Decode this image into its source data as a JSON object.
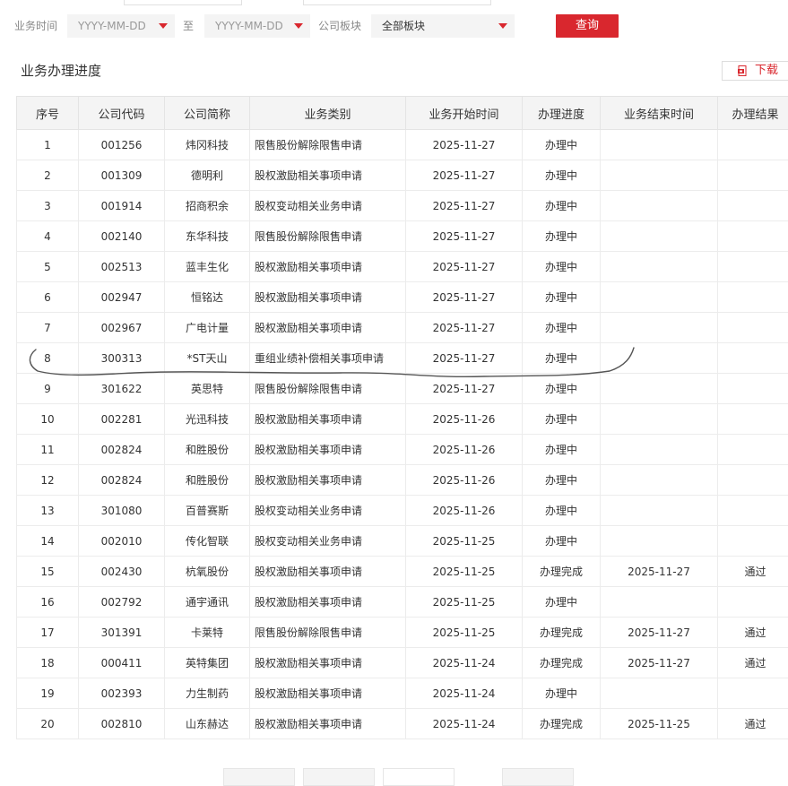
{
  "filters": {
    "date_label": "业务时间",
    "start_placeholder": "YYYY-MM-DD",
    "separator": "至",
    "end_placeholder": "YYYY-MM-DD",
    "board_label": "公司板块",
    "board_value": "全部板块",
    "query_button": "查询"
  },
  "section": {
    "title": "业务办理进度",
    "download_label": "下载"
  },
  "table": {
    "columns": [
      "序号",
      "公司代码",
      "公司简称",
      "业务类别",
      "业务开始时间",
      "办理进度",
      "业务结束时间",
      "办理结果"
    ],
    "rows": [
      [
        "1",
        "001256",
        "炜冈科技",
        "限售股份解除限售申请",
        "2025-11-27",
        "办理中",
        "",
        ""
      ],
      [
        "2",
        "001309",
        "德明利",
        "股权激励相关事项申请",
        "2025-11-27",
        "办理中",
        "",
        ""
      ],
      [
        "3",
        "001914",
        "招商积余",
        "股权变动相关业务申请",
        "2025-11-27",
        "办理中",
        "",
        ""
      ],
      [
        "4",
        "002140",
        "东华科技",
        "限售股份解除限售申请",
        "2025-11-27",
        "办理中",
        "",
        ""
      ],
      [
        "5",
        "002513",
        "蓝丰生化",
        "股权激励相关事项申请",
        "2025-11-27",
        "办理中",
        "",
        ""
      ],
      [
        "6",
        "002947",
        "恒铭达",
        "股权激励相关事项申请",
        "2025-11-27",
        "办理中",
        "",
        ""
      ],
      [
        "7",
        "002967",
        "广电计量",
        "股权激励相关事项申请",
        "2025-11-27",
        "办理中",
        "",
        ""
      ],
      [
        "8",
        "300313",
        "*ST天山",
        "重组业绩补偿相关事项申请",
        "2025-11-27",
        "办理中",
        "",
        ""
      ],
      [
        "9",
        "301622",
        "英思特",
        "限售股份解除限售申请",
        "2025-11-27",
        "办理中",
        "",
        ""
      ],
      [
        "10",
        "002281",
        "光迅科技",
        "股权激励相关事项申请",
        "2025-11-26",
        "办理中",
        "",
        ""
      ],
      [
        "11",
        "002824",
        "和胜股份",
        "股权激励相关事项申请",
        "2025-11-26",
        "办理中",
        "",
        ""
      ],
      [
        "12",
        "002824",
        "和胜股份",
        "股权激励相关事项申请",
        "2025-11-26",
        "办理中",
        "",
        ""
      ],
      [
        "13",
        "301080",
        "百普赛斯",
        "股权变动相关业务申请",
        "2025-11-26",
        "办理中",
        "",
        ""
      ],
      [
        "14",
        "002010",
        "传化智联",
        "股权变动相关业务申请",
        "2025-11-25",
        "办理中",
        "",
        ""
      ],
      [
        "15",
        "002430",
        "杭氧股份",
        "股权激励相关事项申请",
        "2025-11-25",
        "办理完成",
        "2025-11-27",
        "通过"
      ],
      [
        "16",
        "002792",
        "通宇通讯",
        "股权激励相关事项申请",
        "2025-11-25",
        "办理中",
        "",
        ""
      ],
      [
        "17",
        "301391",
        "卡莱特",
        "限售股份解除限售申请",
        "2025-11-25",
        "办理完成",
        "2025-11-27",
        "通过"
      ],
      [
        "18",
        "000411",
        "英特集团",
        "股权激励相关事项申请",
        "2025-11-24",
        "办理完成",
        "2025-11-27",
        "通过"
      ],
      [
        "19",
        "002393",
        "力生制药",
        "股权激励相关事项申请",
        "2025-11-24",
        "办理中",
        "",
        ""
      ],
      [
        "20",
        "002810",
        "山东赫达",
        "股权激励相关事项申请",
        "2025-11-24",
        "办理完成",
        "2025-11-25",
        "通过"
      ]
    ]
  },
  "colors": {
    "accent": "#d9272e",
    "header_bg": "#f4f4f4"
  },
  "icons": {
    "download": "pdf-download-icon",
    "dropdown": "caret-down-icon"
  }
}
